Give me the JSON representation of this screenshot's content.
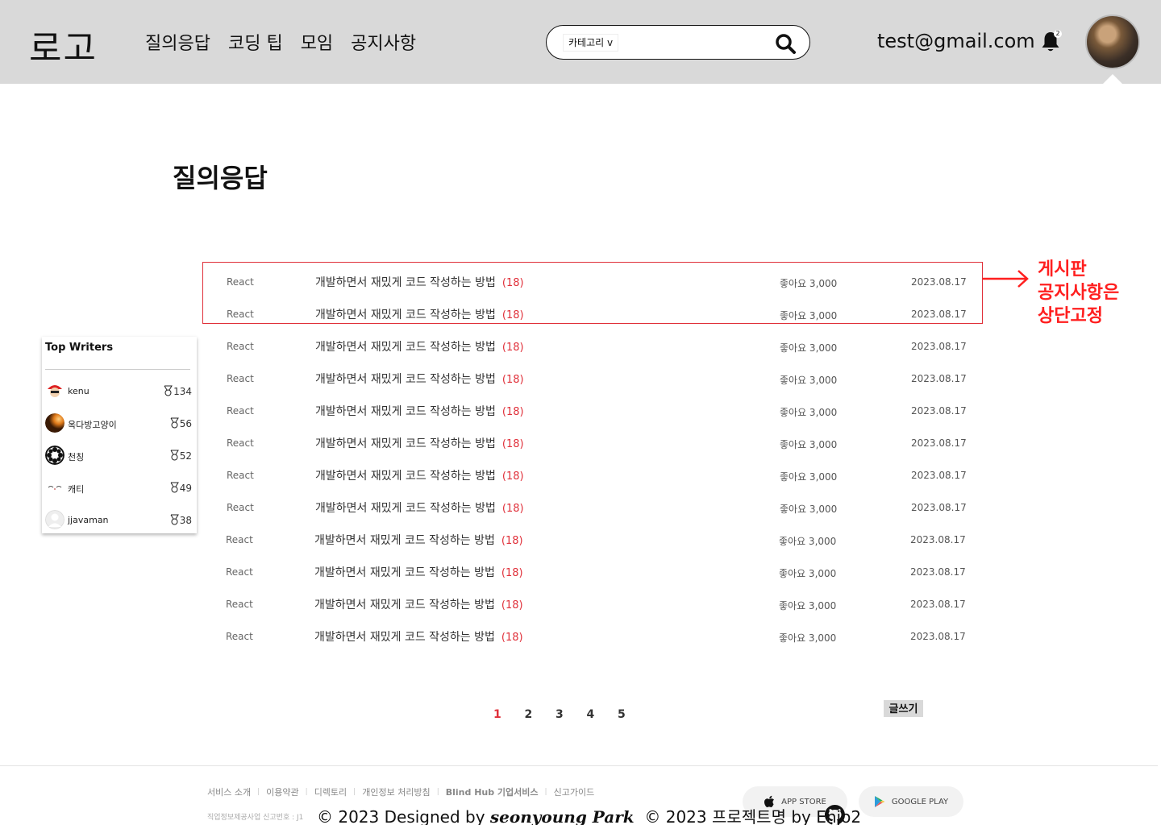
{
  "header": {
    "logo": "로고",
    "nav": [
      "질의응답",
      "코딩 팁",
      "모임",
      "공지사항"
    ],
    "search": {
      "category_label": "카테고리 v",
      "placeholder": ""
    },
    "user_email": "test@gmail.com",
    "notification_count": "2"
  },
  "page": {
    "title": "질의응답"
  },
  "top_writers": {
    "title": "Top Writers",
    "writers": [
      {
        "name": "kenu",
        "count": "134"
      },
      {
        "name": "옥다방고양이",
        "count": "56"
      },
      {
        "name": "천칭",
        "count": "52"
      },
      {
        "name": "캐티",
        "count": "49"
      },
      {
        "name": "jjavaman",
        "count": "38"
      }
    ]
  },
  "posts": [
    {
      "category": "React",
      "title": "개발하면서 재밌게 코드 작성하는 방법",
      "comments": "(18)",
      "likes": "좋아요 3,000",
      "date": "2023.08.17",
      "pinned": true
    },
    {
      "category": "React",
      "title": "개발하면서 재밌게 코드 작성하는 방법",
      "comments": "(18)",
      "likes": "좋아요 3,000",
      "date": "2023.08.17",
      "pinned": true
    },
    {
      "category": "React",
      "title": "개발하면서 재밌게 코드 작성하는 방법",
      "comments": "(18)",
      "likes": "좋아요 3,000",
      "date": "2023.08.17",
      "pinned": false
    },
    {
      "category": "React",
      "title": "개발하면서 재밌게 코드 작성하는 방법",
      "comments": "(18)",
      "likes": "좋아요 3,000",
      "date": "2023.08.17",
      "pinned": false
    },
    {
      "category": "React",
      "title": "개발하면서 재밌게 코드 작성하는 방법",
      "comments": "(18)",
      "likes": "좋아요 3,000",
      "date": "2023.08.17",
      "pinned": false
    },
    {
      "category": "React",
      "title": "개발하면서 재밌게 코드 작성하는 방법",
      "comments": "(18)",
      "likes": "좋아요 3,000",
      "date": "2023.08.17",
      "pinned": false
    },
    {
      "category": "React",
      "title": "개발하면서 재밌게 코드 작성하는 방법",
      "comments": "(18)",
      "likes": "좋아요 3,000",
      "date": "2023.08.17",
      "pinned": false
    },
    {
      "category": "React",
      "title": "개발하면서 재밌게 코드 작성하는 방법",
      "comments": "(18)",
      "likes": "좋아요 3,000",
      "date": "2023.08.17",
      "pinned": false
    },
    {
      "category": "React",
      "title": "개발하면서 재밌게 코드 작성하는 방법",
      "comments": "(18)",
      "likes": "좋아요 3,000",
      "date": "2023.08.17",
      "pinned": false
    },
    {
      "category": "React",
      "title": "개발하면서 재밌게 코드 작성하는 방법",
      "comments": "(18)",
      "likes": "좋아요 3,000",
      "date": "2023.08.17",
      "pinned": false
    },
    {
      "category": "React",
      "title": "개발하면서 재밌게 코드 작성하는 방법",
      "comments": "(18)",
      "likes": "좋아요 3,000",
      "date": "2023.08.17",
      "pinned": false
    },
    {
      "category": "React",
      "title": "개발하면서 재밌게 코드 작성하는 방법",
      "comments": "(18)",
      "likes": "좋아요 3,000",
      "date": "2023.08.17",
      "pinned": false
    }
  ],
  "annotation": {
    "lines": [
      "게시판",
      "공지사항은",
      "상단고정"
    ]
  },
  "pagination": {
    "pages": [
      "1",
      "2",
      "3",
      "4",
      "5"
    ],
    "current": "1"
  },
  "write_button": "글쓰기",
  "footer": {
    "links": [
      "서비스 소개",
      "이용약관",
      "디렉토리",
      "개인정보 처리방침",
      "Blind Hub 기업서비스",
      "신고가이드"
    ],
    "biz_info": "직업정보제공사업 신고번호 : J1",
    "app_store": "APP STORE",
    "google_play": "GOOGLE PLAY",
    "copyright_prefix": "© 2023 Designed by ",
    "designer": "seonyoung Park",
    "copyright_suffix": "  © 2023 프로젝트명 by Enjo2"
  },
  "colors": {
    "accent": "#e0303a",
    "annotation": "#ff1f1f",
    "header_bg": "#d9d9d9"
  }
}
